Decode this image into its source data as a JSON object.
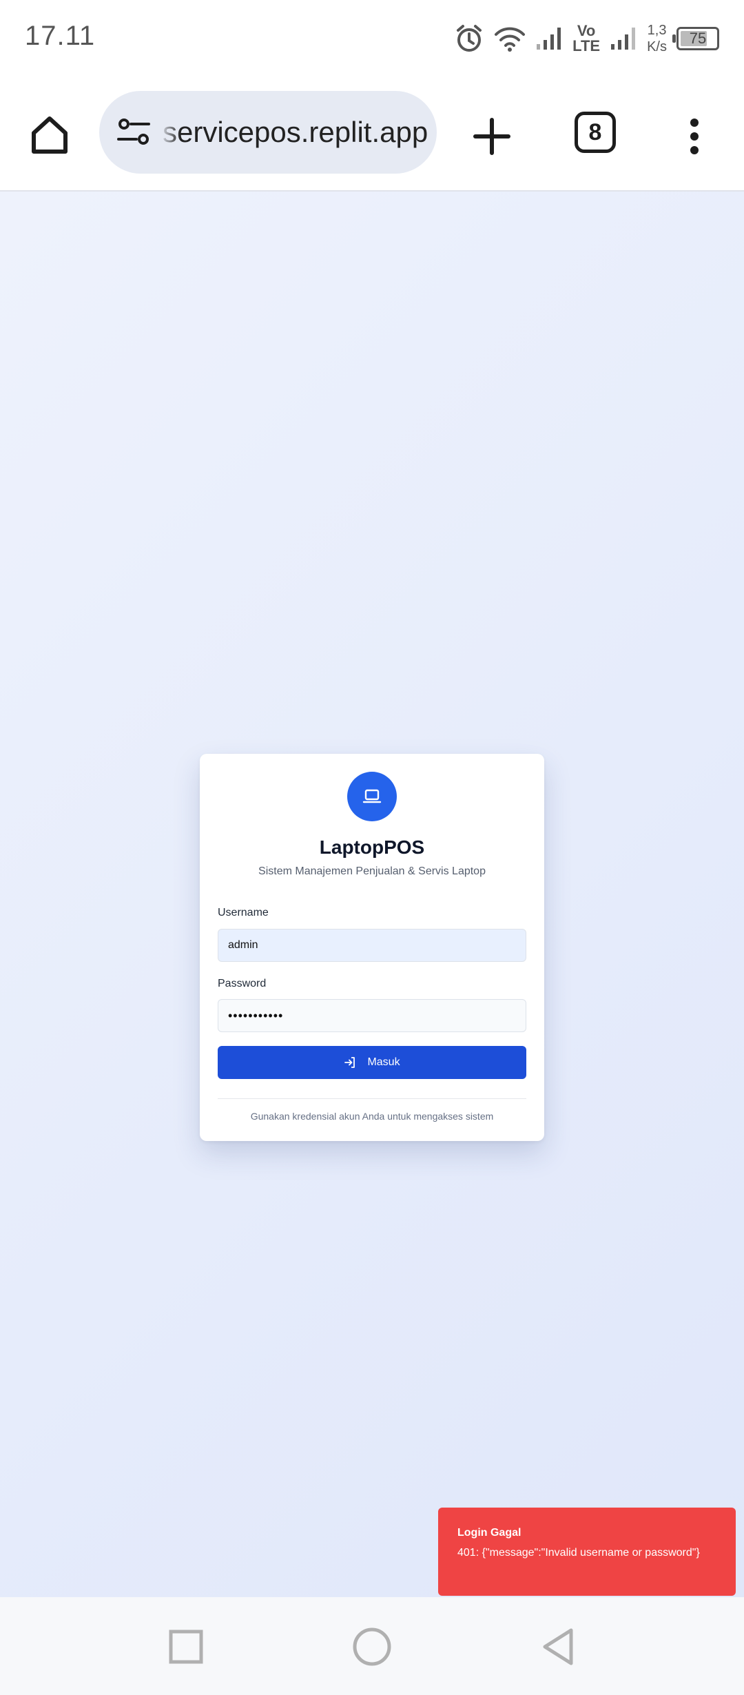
{
  "status_bar": {
    "time": "17.11",
    "volte_top": "Vo",
    "volte_bottom": "LTE",
    "speed_value": "1,3",
    "speed_unit": "K/s",
    "battery": "75",
    "icons": [
      "alarm-icon",
      "wifi-icon",
      "signal-icon",
      "signal-icon"
    ]
  },
  "browser": {
    "url": "servicepos.replit.app",
    "tab_count": "8",
    "icons": [
      "home-icon",
      "site-settings-icon",
      "new-tab-icon",
      "tab-switcher-icon",
      "more-vert-icon"
    ]
  },
  "login": {
    "logo_icon": "laptop-icon",
    "title": "LaptopPOS",
    "subtitle": "Sistem Manajemen Penjualan & Servis Laptop",
    "username_label": "Username",
    "username_value": "admin",
    "password_label": "Password",
    "password_value": "•••••••••••",
    "submit_label": "Masuk",
    "submit_icon": "login-icon",
    "footnote": "Gunakan kredensial akun Anda untuk mengakses sistem",
    "accent_color": "#1d4ed8"
  },
  "toast": {
    "title": "Login Gagal",
    "message": "401: {\"message\":\"Invalid username or password\"}",
    "color": "#ef4444"
  },
  "nav_bar": {
    "icons": [
      "recents-icon",
      "home-circle-icon",
      "back-icon"
    ]
  }
}
